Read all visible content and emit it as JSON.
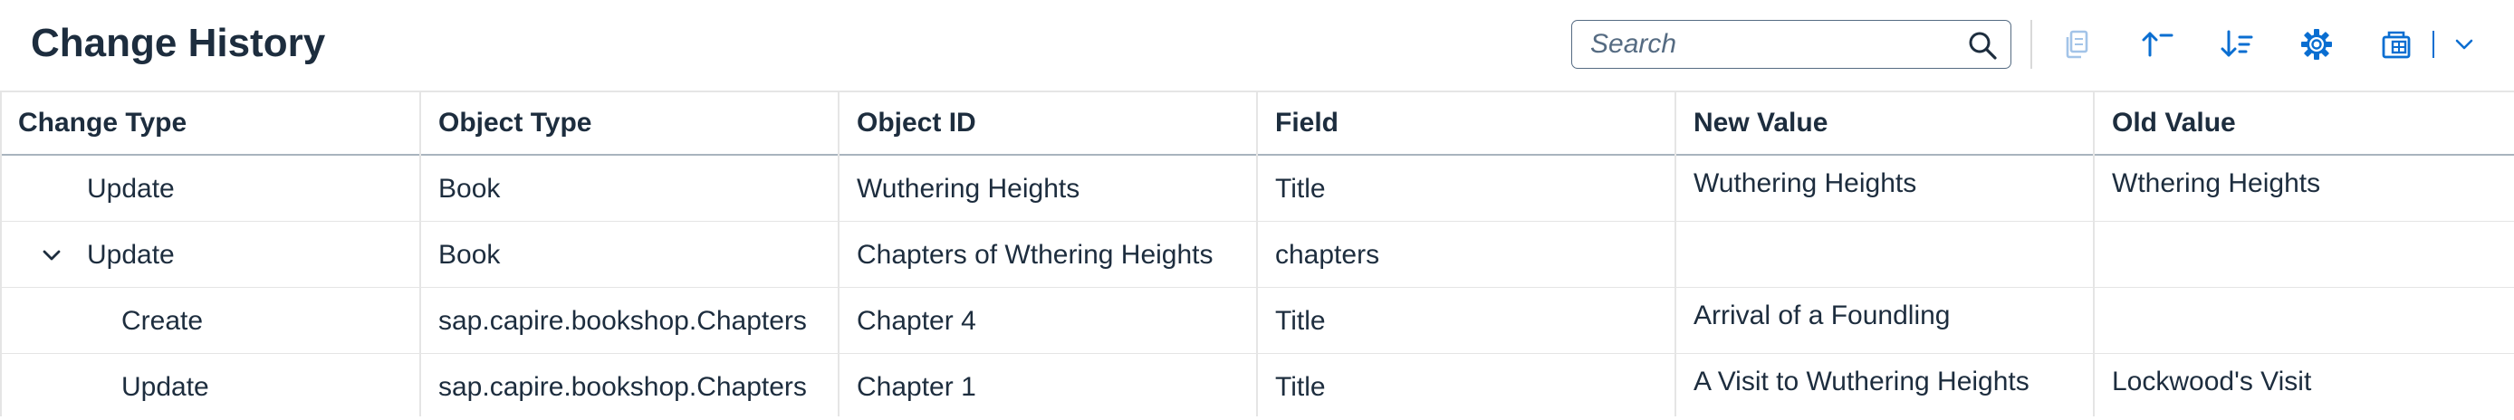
{
  "header": {
    "title": "Change History",
    "search_placeholder": "Search"
  },
  "toolbar": {
    "icons": [
      "copy-icon",
      "sort-ascending-icon",
      "sort-descending-icon",
      "settings-icon",
      "export-icon",
      "chevron-down-icon"
    ]
  },
  "table": {
    "columns": [
      "Change Type",
      "Object Type",
      "Object ID",
      "Field",
      "New Value",
      "Old Value"
    ],
    "rows": [
      {
        "change_type": "Update",
        "object_type": "Book",
        "object_id": "Wuthering Heights",
        "field": "Title",
        "new_value": "Wuthering Heights",
        "old_value": "Wthering Heights"
      },
      {
        "change_type": "Update",
        "object_type": "Book",
        "object_id": "Chapters of Wthering Heights",
        "field": "chapters",
        "new_value": "",
        "old_value": ""
      },
      {
        "change_type": "Create",
        "object_type": "sap.capire.bookshop.Chapters",
        "object_id": "Chapter 4",
        "field": "Title",
        "new_value": "Arrival of a Foundling",
        "old_value": ""
      },
      {
        "change_type": "Update",
        "object_type": "sap.capire.bookshop.Chapters",
        "object_id": "Chapter 1",
        "field": "Title",
        "new_value": "A Visit to Wuthering Heights",
        "old_value": "Lockwood's Visit"
      }
    ]
  },
  "colors": {
    "accent": "#0a6ed1",
    "text": "#1d2d3e",
    "disabled_icon": "#a3c4e8",
    "border": "#e5e5e5"
  }
}
